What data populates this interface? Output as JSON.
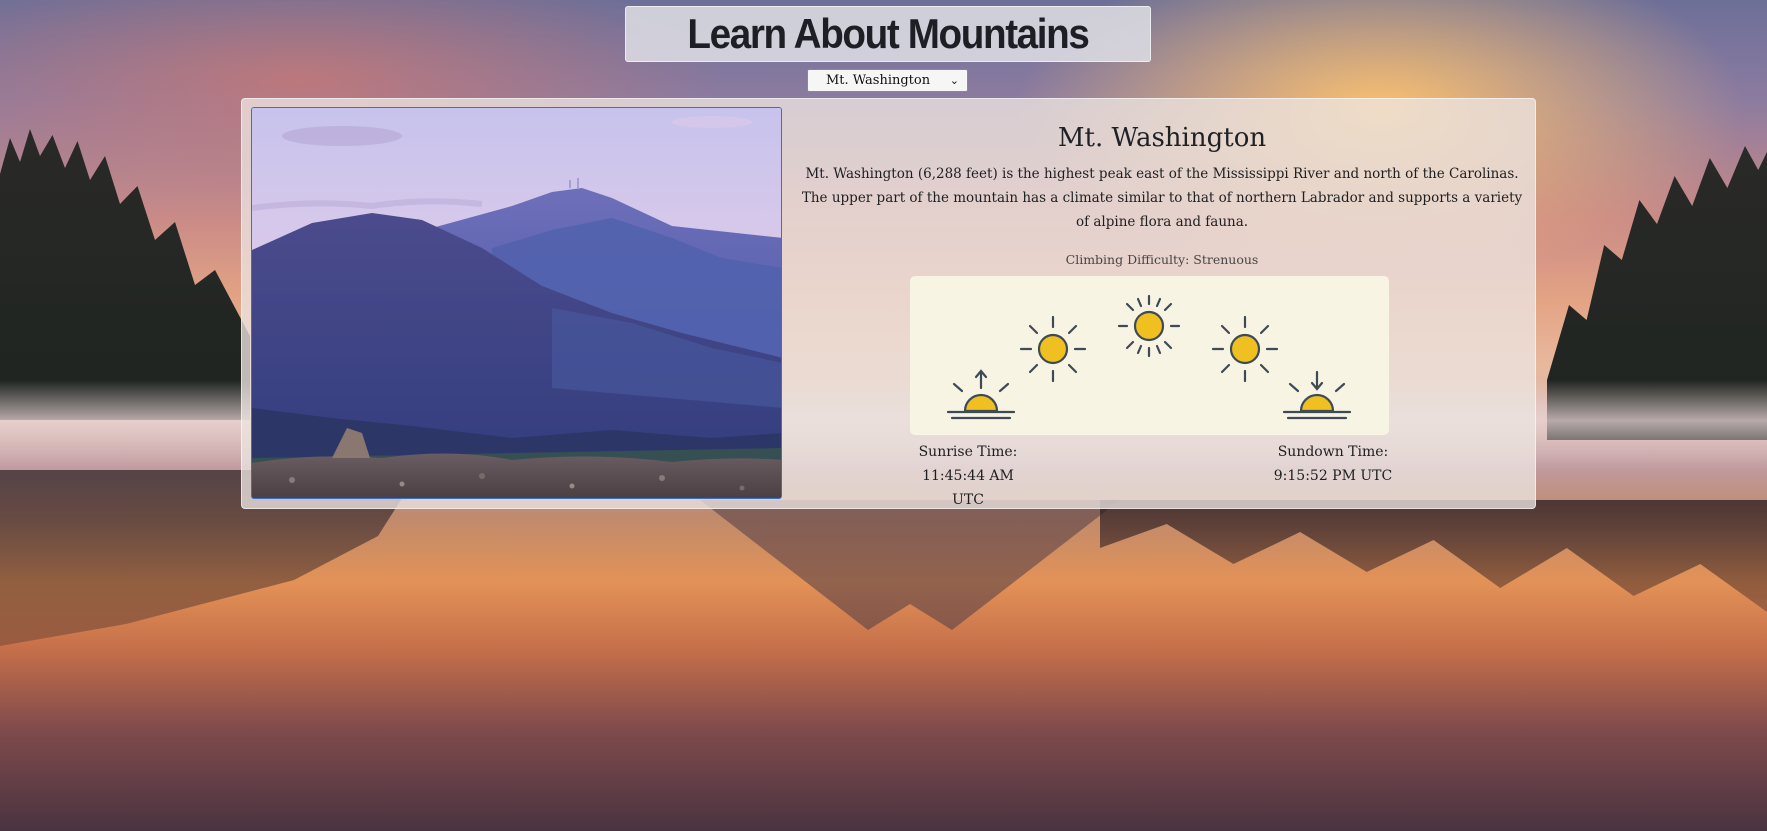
{
  "header": {
    "title": "Learn About Mountains"
  },
  "selector": {
    "selected": "Mt. Washington",
    "chevron_icon": "chevron-down-icon"
  },
  "mountain": {
    "name": "Mt. Washington",
    "description": "Mt. Washington (6,288 feet) is the highest peak east of the Mississippi River and north of the Carolinas. The upper part of the mountain has a climate similar to that of northern Labrador and supports a variety of alpine flora and fauna.",
    "difficulty": "Climbing Difficulty: Strenuous",
    "sunrise_label": "Sunrise Time:",
    "sunrise_time": "11:45:44 AM UTC",
    "sundown_label": "Sundown Time:",
    "sundown_time": "9:15:52 PM UTC"
  },
  "sun_panel": {
    "icons": [
      "sunrise-icon",
      "morning-sun-icon",
      "noon-sun-icon",
      "afternoon-sun-icon",
      "sunset-icon"
    ],
    "sun_color": "#f0c020",
    "stroke_color": "#3e4a55"
  },
  "colors": {
    "card_bg": "#ece4e0",
    "photo_border": "#3b6fcf",
    "panel_bg": "#f8f4e4"
  }
}
